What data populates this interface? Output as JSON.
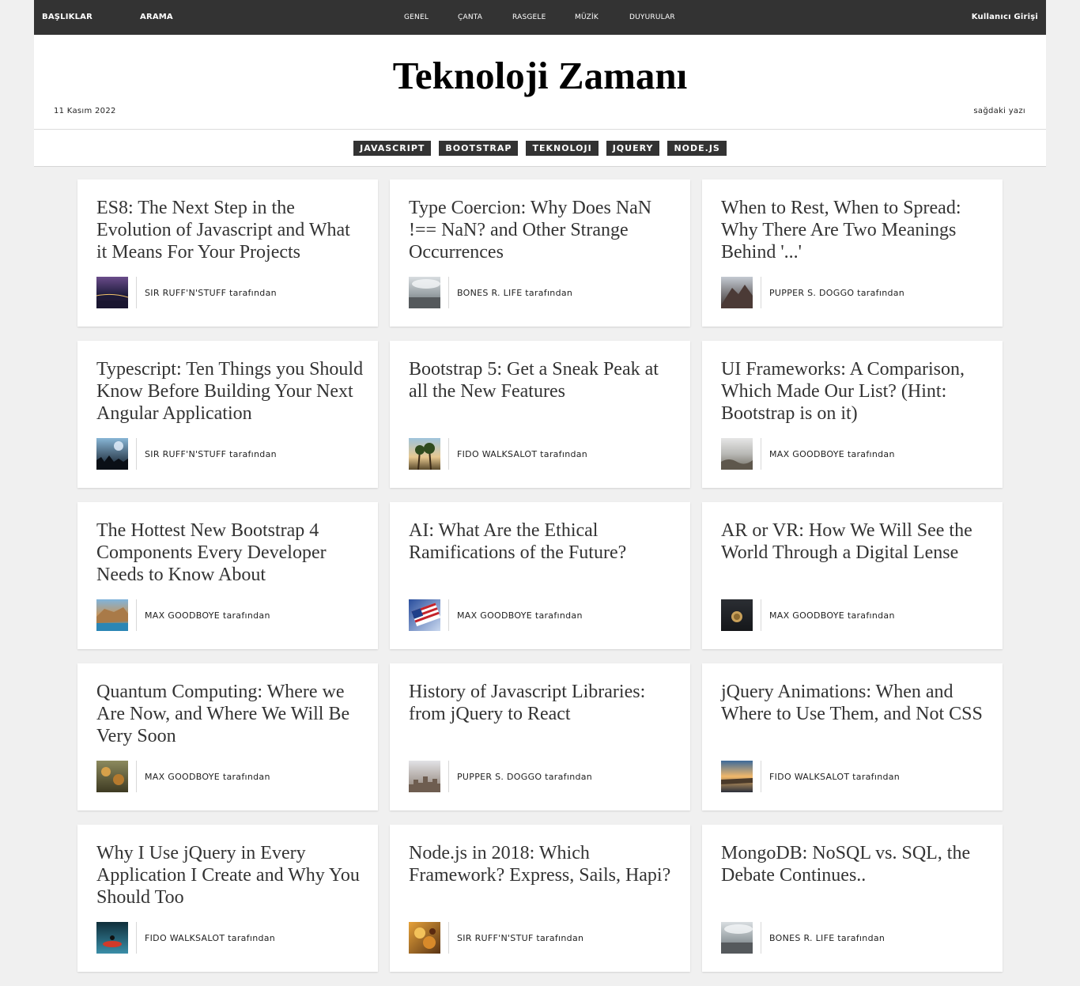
{
  "nav": {
    "left": [
      "BAŞLIKLAR",
      "ARAMA"
    ],
    "center": [
      "GENEL",
      "ÇANTA",
      "RASGELE",
      "MÜZİK",
      "DUYURULAR"
    ],
    "login": "Kullanıcı Girişi"
  },
  "masthead": {
    "title": "Teknoloji Zamanı",
    "date": "11 Kasım 2022",
    "right_text": "sağdaki yazı"
  },
  "tags": [
    "JAVASCRIPT",
    "BOOTSTRAP",
    "TEKNOLOJI",
    "JQUERY",
    "NODE.JS"
  ],
  "byline_suffix": "tarafından",
  "articles": [
    {
      "title": "ES8: The Next Step in the Evolution of Javascript and What it Means For Your Projects",
      "author": "SIR RUFF'N'STUFF",
      "byline": "SIR RUFF'N'STUFF tarafından",
      "thumb": "bridge-night-image"
    },
    {
      "title": "Type Coercion: Why Does NaN !== NaN? and Other Strange Occurrences",
      "author": "BONES R. LIFE",
      "byline": "BONES R. LIFE tarafından",
      "thumb": "cloudy-sea-image"
    },
    {
      "title": "When to Rest, When to Spread: Why There Are Two Meanings Behind '...'",
      "author": "PUPPER S. DOGGO",
      "byline": "PUPPER S. DOGGO tarafından",
      "thumb": "mountain-image"
    },
    {
      "title": "Typescript: Ten Things you Should Know Before Building Your Next Angular Application",
      "author": "SIR RUFF'N'STUFF",
      "byline": "SIR RUFF'N'STUFF tarafından",
      "thumb": "concert-crowd-image"
    },
    {
      "title": "Bootstrap 5: Get a Sneak Peak at all the New Features",
      "author": "FIDO WALKSALOT",
      "byline": "FIDO WALKSALOT tarafından",
      "thumb": "palm-trees-image"
    },
    {
      "title": "UI Frameworks: A Comparison, Which Made Our List? (Hint: Bootstrap is on it)",
      "author": "MAX GOODBOYE",
      "byline": "MAX GOODBOYE tarafından",
      "thumb": "rocky-shore-image"
    },
    {
      "title": "The Hottest New Bootstrap 4 Components Every Developer Needs to Know About",
      "author": "MAX GOODBOYE",
      "byline": "MAX GOODBOYE tarafından",
      "thumb": "coastal-cliffs-image"
    },
    {
      "title": "AI: What Are the Ethical Ramifications of the Future?",
      "author": "MAX GOODBOYE",
      "byline": "MAX GOODBOYE tarafından",
      "thumb": "us-flag-image"
    },
    {
      "title": "AR or VR: How We Will See the World Through a Digital Lense",
      "author": "MAX GOODBOYE",
      "byline": "MAX GOODBOYE tarafından",
      "thumb": "coins-image"
    },
    {
      "title": "Quantum Computing: Where we Are Now, and Where We Will Be Very Soon",
      "author": "MAX GOODBOYE",
      "byline": "MAX GOODBOYE tarafından",
      "thumb": "autumn-leaves-image"
    },
    {
      "title": "History of Javascript Libraries: from jQuery to React",
      "author": "PUPPER S. DOGGO",
      "byline": "PUPPER S. DOGGO tarafından",
      "thumb": "city-skyline-image"
    },
    {
      "title": "jQuery Animations: When and Where to Use Them, and Not CSS",
      "author": "FIDO WALKSALOT",
      "byline": "FIDO WALKSALOT tarafından",
      "thumb": "sunset-lake-image"
    },
    {
      "title": "Why I Use jQuery in Every Application I Create and Why You Should Too",
      "author": "FIDO WALKSALOT",
      "byline": "FIDO WALKSALOT tarafından",
      "thumb": "kayak-image"
    },
    {
      "title": "Node.js in 2018: Which Framework? Express, Sails, Hapi?",
      "author": "SIR RUFF'N'STUF",
      "byline": "SIR RUFF'N'STUF tarafından",
      "thumb": "food-image"
    },
    {
      "title": "MongoDB: NoSQL vs. SQL, the Debate Continues..",
      "author": "BONES R. LIFE",
      "byline": "BONES R. LIFE tarafından",
      "thumb": "cloudy-sea-image"
    }
  ]
}
